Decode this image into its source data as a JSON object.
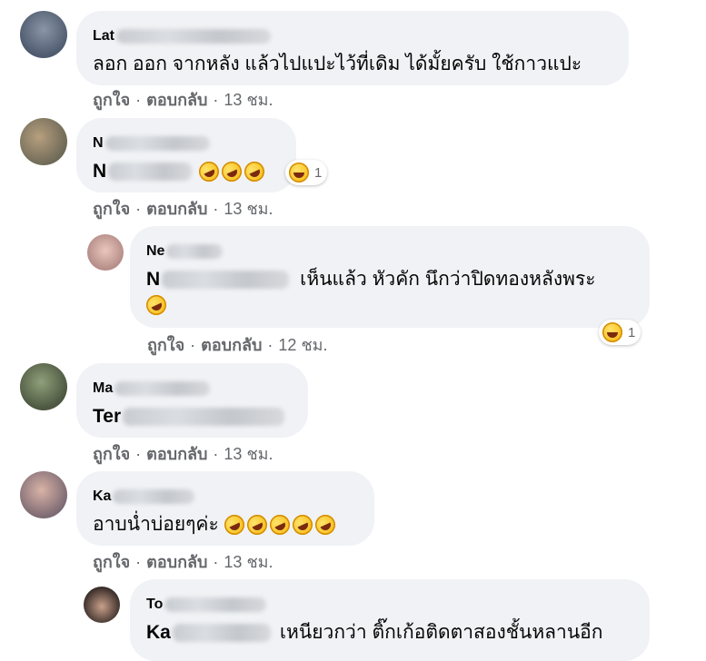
{
  "comments": [
    {
      "author_visible": "Lat",
      "text": "ลอก ออก จากหลัง แล้วไปแปะไว้ที่เดิม ได้มั้ยครับ ใช้กาวแปะ",
      "like": "ถูกใจ",
      "reply": "ตอบกลับ",
      "time": "13 ชม."
    },
    {
      "author_visible": "N",
      "text_prefix": "N",
      "reaction_count": "1",
      "like": "ถูกใจ",
      "reply": "ตอบกลับ",
      "time": "13 ชม."
    },
    {
      "author_visible": "Ne",
      "mention_prefix": "N",
      "text": "เห็นแล้ว หัวคัก นึกว่าปิดทองหลังพระ",
      "reaction_count": "1",
      "like": "ถูกใจ",
      "reply": "ตอบกลับ",
      "time": "12 ชม."
    },
    {
      "author_visible": "Ma",
      "text_prefix": "Ter",
      "like": "ถูกใจ",
      "reply": "ตอบกลับ",
      "time": "13 ชม."
    },
    {
      "author_visible": "Ka",
      "text": "อาบน่ำบ่อยๆค่ะ",
      "like": "ถูกใจ",
      "reply": "ตอบกลับ",
      "time": "13 ชม."
    },
    {
      "author_visible": "To",
      "mention_prefix": "Ka",
      "text": "เหนียวกว่า ติ๊กเก้อติดตาสองชั้นหลานอีก"
    }
  ],
  "separator": "·",
  "icons": {
    "laugh": "rolling-on-floor-laughing-emoji",
    "haha": "haha-reaction-icon"
  }
}
